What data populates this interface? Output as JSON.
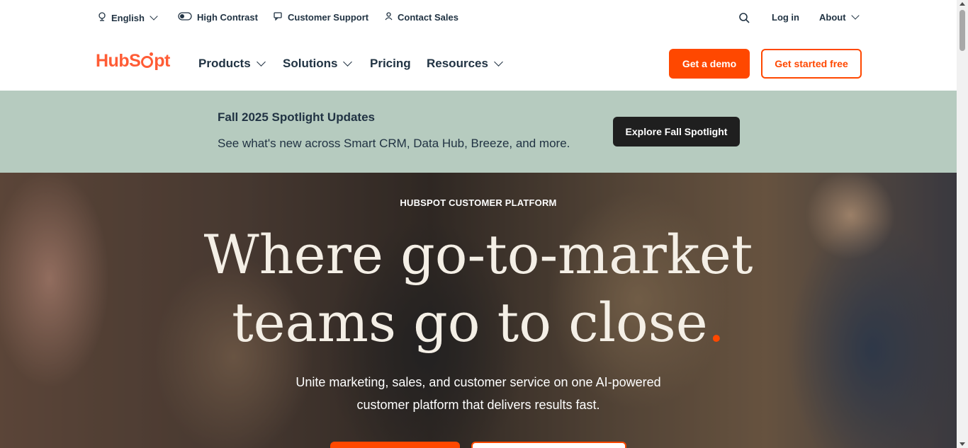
{
  "utility": {
    "language": "English",
    "high_contrast": "High Contrast",
    "customer_support": "Customer Support",
    "contact_sales": "Contact Sales",
    "login": "Log in",
    "about": "About"
  },
  "nav": {
    "logo": {
      "part1": "HubS",
      "part2": "pt"
    },
    "items": [
      "Products",
      "Solutions",
      "Pricing",
      "Resources"
    ],
    "demo_button": "Get a demo",
    "free_button": "Get started free"
  },
  "announcement": {
    "title": "Fall 2025 Spotlight Updates",
    "subtitle": "See what's new across Smart CRM, Data Hub, Breeze, and more.",
    "button": "Explore Fall Spotlight"
  },
  "hero": {
    "eyebrow": "HUBSPOT CUSTOMER PLATFORM",
    "title_line1": "Where go-to-market",
    "title_line2": "teams go to close",
    "title_dot": ".",
    "subtitle_line1": "Unite marketing, sales, and customer service on one AI-powered",
    "subtitle_line2": "customer platform that delivers results fast."
  },
  "colors": {
    "brand_orange": "#ff4800",
    "ink": "#213343",
    "banner_bg": "#b6cbbf"
  }
}
